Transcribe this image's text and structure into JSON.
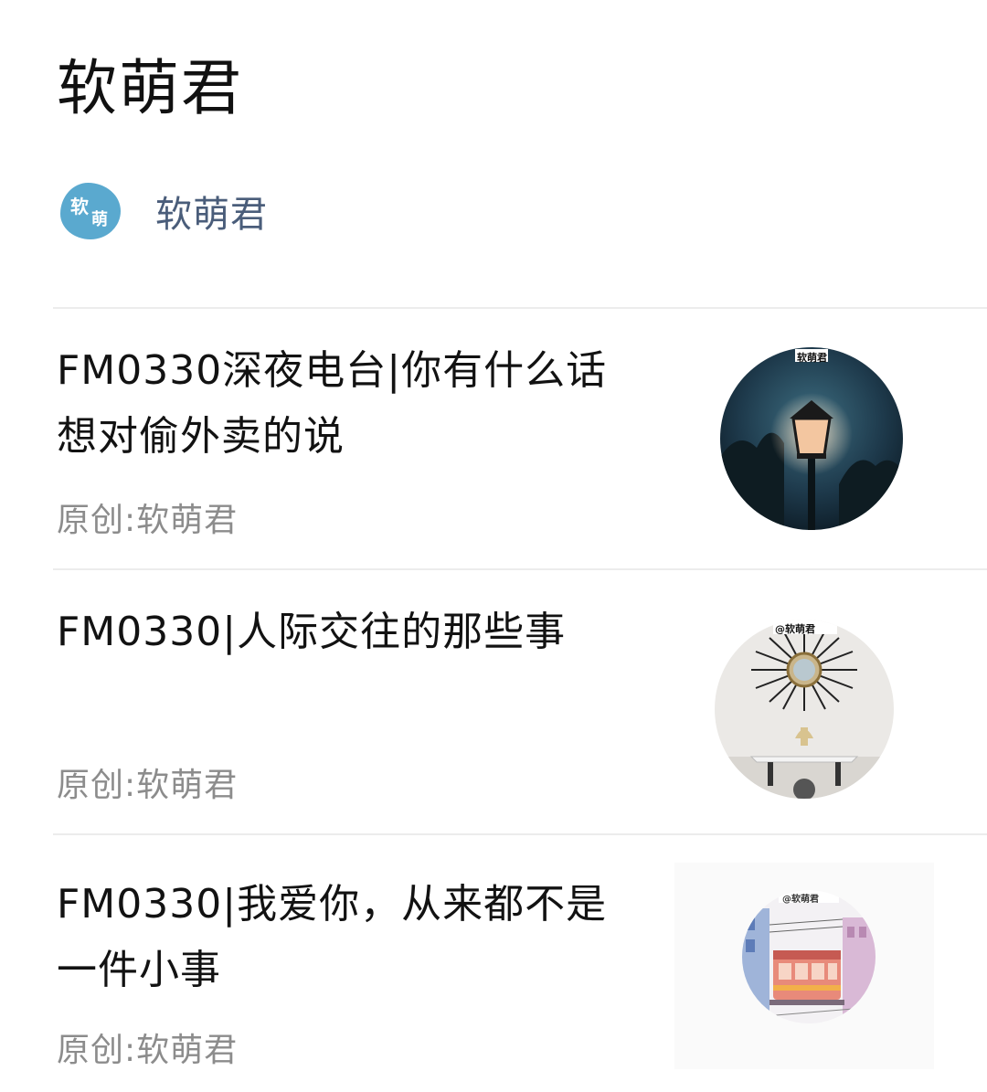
{
  "page": {
    "title": "软萌君"
  },
  "account": {
    "name": "软萌君",
    "avatar_glyph_1": "软",
    "avatar_glyph_2": "萌",
    "avatar_color": "#5aa9cf"
  },
  "articles": [
    {
      "title": "FM0330深夜电台|你有什么话想对偷外卖的说",
      "source": "原创:软萌君",
      "thumb_label": "软萌君",
      "thumb_icon": "street-lamp-image"
    },
    {
      "title": "FM0330|人际交往的那些事",
      "source": "原创:软萌君",
      "thumb_label": "@软萌君",
      "thumb_icon": "sunburst-mirror-image"
    },
    {
      "title": "FM0330|我爱你，从来都不是一件小事",
      "source": "原创:软萌君",
      "thumb_label": "@软萌君",
      "thumb_icon": "tram-street-image"
    }
  ],
  "colors": {
    "title_text": "#121212",
    "source_text": "#8c8c8c",
    "account_name": "#4a5d7a",
    "divider": "#ececec"
  }
}
